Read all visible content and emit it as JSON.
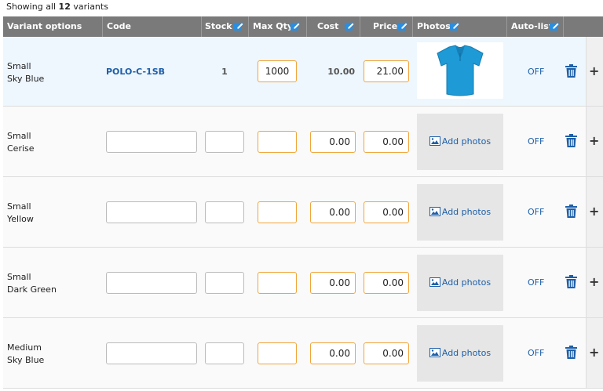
{
  "showing": {
    "prefix": "Showing all",
    "count": "12",
    "suffix": "variants"
  },
  "headers": [
    {
      "key": "variant",
      "label": "Variant options",
      "editable": false
    },
    {
      "key": "code",
      "label": "Code",
      "editable": false
    },
    {
      "key": "stock",
      "label": "Stock",
      "editable": true
    },
    {
      "key": "maxqty",
      "label": "Max Qty",
      "editable": true
    },
    {
      "key": "cost",
      "label": "Cost",
      "editable": true
    },
    {
      "key": "price",
      "label": "Price",
      "editable": true
    },
    {
      "key": "photos",
      "label": "Photos",
      "editable": true
    },
    {
      "key": "autolist",
      "label": "Auto-list",
      "editable": true
    }
  ],
  "add_photos_label": "Add photos",
  "rows": [
    {
      "size": "Small",
      "color": "Sky Blue",
      "code": "POLO-C-1SB",
      "stock": "1",
      "maxqty": "1000",
      "cost": "10.00",
      "price": "21.00",
      "has_photo": true,
      "autolist": "OFF"
    },
    {
      "size": "Small",
      "color": "Cerise",
      "code": "",
      "stock": "",
      "maxqty": "",
      "cost": "0.00",
      "price": "0.00",
      "has_photo": false,
      "autolist": "OFF"
    },
    {
      "size": "Small",
      "color": "Yellow",
      "code": "",
      "stock": "",
      "maxqty": "",
      "cost": "0.00",
      "price": "0.00",
      "has_photo": false,
      "autolist": "OFF"
    },
    {
      "size": "Small",
      "color": "Dark Green",
      "code": "",
      "stock": "",
      "maxqty": "",
      "cost": "0.00",
      "price": "0.00",
      "has_photo": false,
      "autolist": "OFF"
    },
    {
      "size": "Medium",
      "color": "Sky Blue",
      "code": "",
      "stock": "",
      "maxqty": "",
      "cost": "0.00",
      "price": "0.00",
      "has_photo": false,
      "autolist": "OFF"
    }
  ],
  "colors": {
    "link": "#1d5fa8",
    "header_bg": "#7a7a7a",
    "input_accent": "#f0a53a",
    "shirt": "#1e9ad6"
  }
}
